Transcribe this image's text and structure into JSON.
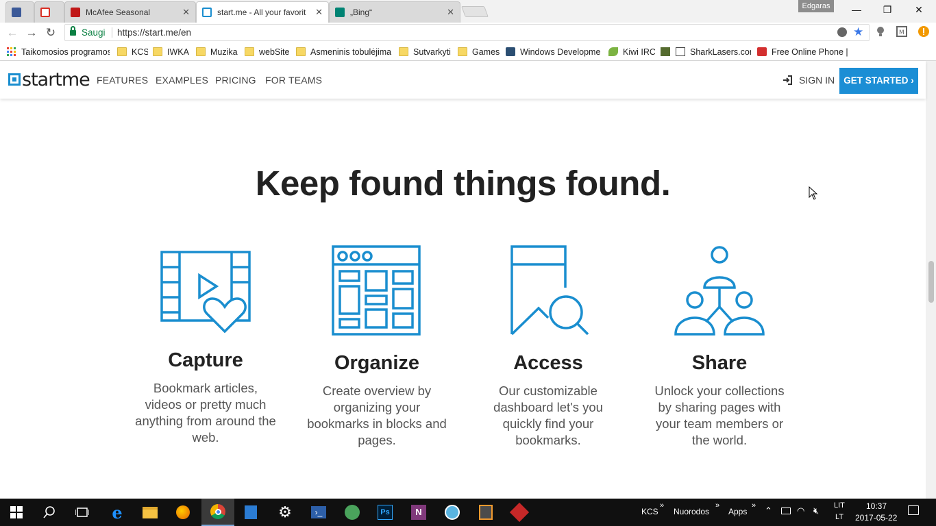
{
  "browser": {
    "tabs": [
      {
        "title": "",
        "favicon": "facebook-icon",
        "color": "#3b5998"
      },
      {
        "title": "",
        "favicon": "gmail-icon",
        "color": "#d93025"
      },
      {
        "title": "McAfee Seasonal",
        "favicon": "mcafee-icon",
        "color": "#c01818"
      },
      {
        "title": "start.me - All your favorit",
        "favicon": "startme-icon",
        "color": "#1a8ecf"
      },
      {
        "title": "„Bing“",
        "favicon": "bing-icon",
        "color": "#008373"
      }
    ],
    "profile_name": "Edgaras",
    "window_controls": {
      "minimize": "—",
      "restore": "❐",
      "close": "✕"
    },
    "secure_label": "Saugi",
    "url": "https://start.me/en",
    "bookmarks": [
      {
        "label": "Taikomosios programos",
        "icon": "apps-grid-icon"
      },
      {
        "label": "KCS",
        "icon": "folder-icon"
      },
      {
        "label": "IWKA",
        "icon": "folder-icon"
      },
      {
        "label": "Muzika",
        "icon": "folder-icon"
      },
      {
        "label": "webSite",
        "icon": "folder-icon"
      },
      {
        "label": "Asmeninis tobulėjima",
        "icon": "folder-icon"
      },
      {
        "label": "Sutvarkyti",
        "icon": "folder-icon"
      },
      {
        "label": "Games",
        "icon": "folder-icon"
      },
      {
        "label": "Windows Developmer",
        "icon": "windows-dev-icon"
      },
      {
        "label": "Kiwi IRC",
        "icon": "kiwi-icon"
      },
      {
        "label": "SharkLasers.com",
        "icon": "sharklasers-icon"
      },
      {
        "label": "Free Online Phone | R",
        "icon": "sms-icon"
      }
    ]
  },
  "site": {
    "logo_text": "startme",
    "nav": [
      "FEATURES",
      "EXAMPLES",
      "PRICING",
      "FOR TEAMS"
    ],
    "sign_in": "SIGN IN",
    "get_started": "GET STARTED ›",
    "headline": "Keep found things found.",
    "features": [
      {
        "title": "Capture",
        "desc": "Bookmark articles, videos or pretty much anything from around the web.",
        "icon": "capture-video-heart-icon"
      },
      {
        "title": "Organize",
        "desc": "Create overview by organizing your bookmarks in blocks and pages.",
        "icon": "organize-dashboard-icon"
      },
      {
        "title": "Access",
        "desc": "Our customizable dashboard let's you quickly find your bookmarks.",
        "icon": "access-bookmark-search-icon"
      },
      {
        "title": "Share",
        "desc": "Unlock your collections by sharing pages with your team members or the world.",
        "icon": "share-people-icon"
      }
    ],
    "accent_color": "#1b8ed5"
  },
  "taskbar": {
    "tray_labels": [
      "KCS",
      "Nuorodos",
      "Apps"
    ],
    "language": {
      "top": "LIT",
      "bottom": "LT"
    },
    "time": "10:37",
    "date": "2017-05-22"
  }
}
